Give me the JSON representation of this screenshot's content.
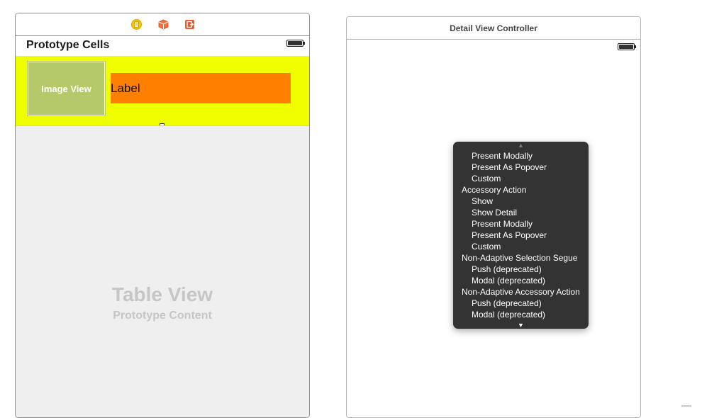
{
  "left_scene": {
    "prototype_cells_title": "Prototype Cells",
    "image_view_label": "Image View",
    "cell_label_text": "Label",
    "table_view_title": "Table View",
    "table_view_subtitle": "Prototype Content",
    "dock_icons": [
      "view-controller-icon",
      "first-responder-icon",
      "exit-icon"
    ]
  },
  "right_scene": {
    "title": "Detail View Controller"
  },
  "segue_menu": {
    "items": [
      {
        "label": "Present Modally",
        "kind": "option"
      },
      {
        "label": "Present As Popover",
        "kind": "option"
      },
      {
        "label": "Custom",
        "kind": "option"
      },
      {
        "label": "Accessory Action",
        "kind": "group"
      },
      {
        "label": "Show",
        "kind": "option"
      },
      {
        "label": "Show Detail",
        "kind": "option"
      },
      {
        "label": "Present Modally",
        "kind": "option"
      },
      {
        "label": "Present As Popover",
        "kind": "option"
      },
      {
        "label": "Custom",
        "kind": "option"
      },
      {
        "label": "Non-Adaptive Selection Segue",
        "kind": "group"
      },
      {
        "label": "Push (deprecated)",
        "kind": "option"
      },
      {
        "label": "Modal (deprecated)",
        "kind": "option"
      },
      {
        "label": "Non-Adaptive Accessory Action",
        "kind": "group"
      },
      {
        "label": "Push (deprecated)",
        "kind": "option"
      },
      {
        "label": "Modal (deprecated)",
        "kind": "option"
      }
    ],
    "scroll_up_glyph": "▲",
    "scroll_down_glyph": "▼"
  },
  "colors": {
    "cell_background": "#f0ff00",
    "label_background": "#ff7f00",
    "image_view_background": "#b5c86a",
    "menu_background": "#333333"
  }
}
